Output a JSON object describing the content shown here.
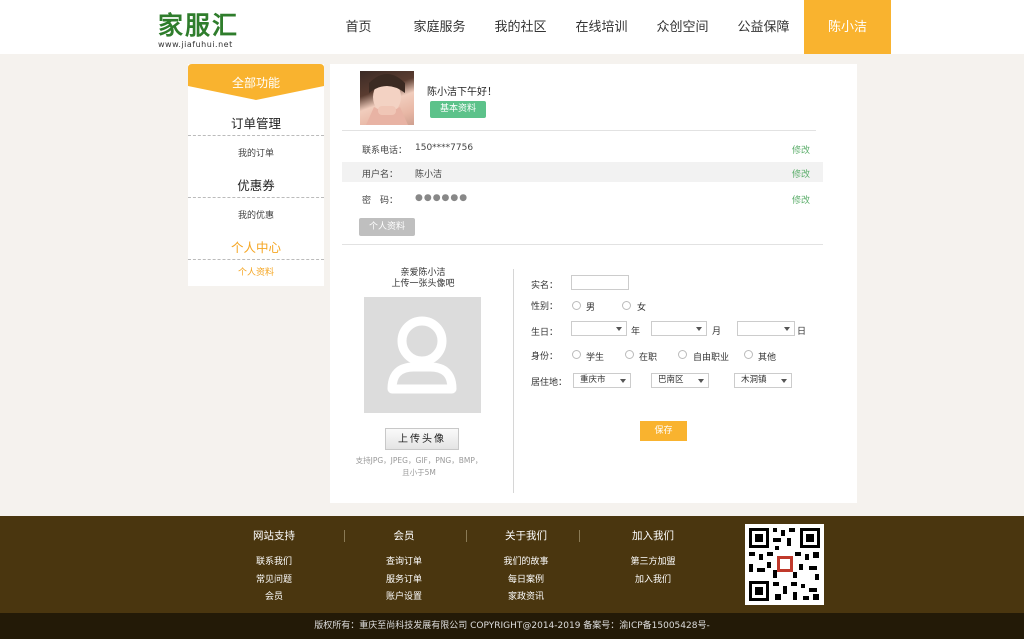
{
  "header": {
    "logo_text": "家服汇",
    "logo_url": "www.jiafuhui.net",
    "nav": [
      "首页",
      "家庭服务",
      "我的社区",
      "在线培训",
      "众创空间",
      "公益保障"
    ],
    "user_name": "陈小洁",
    "accent_color": "#f9b32f"
  },
  "sidebar": {
    "header": "全部功能",
    "sections": [
      {
        "title": "订单管理",
        "items": [
          "我的订单"
        ]
      },
      {
        "title": "优惠券",
        "items": [
          "我的优惠"
        ]
      },
      {
        "title": "个人中心",
        "items": [
          "个人资料"
        ],
        "active": true
      }
    ]
  },
  "profile": {
    "greeting": "陈小洁下午好！",
    "basic_button": "基本资料",
    "rows": [
      {
        "label": "联系电话：",
        "value": "150****7756",
        "edit": "修改"
      },
      {
        "label": "用户名：",
        "value": "陈小洁",
        "edit": "修改"
      },
      {
        "label": "密　码：",
        "value": "●●●●●●",
        "edit": "修改"
      }
    ],
    "profile_button": "个人资料"
  },
  "upload": {
    "line1": "亲爱陈小洁",
    "line2": "上传一张头像吧",
    "button": "上传头像",
    "note1": "支持JPG，JPEG，GIF，PNG，BMP，",
    "note2": "且小于5M"
  },
  "form": {
    "realname_label": "实名：",
    "gender_label": "性别：",
    "gender_options": [
      "男",
      "女"
    ],
    "birthday_label": "生日：",
    "birthday_units": [
      "年",
      "月",
      "日"
    ],
    "identity_label": "身份：",
    "identity_options": [
      "学生",
      "在职",
      "自由职业",
      "其他"
    ],
    "residence_label": "居住地：",
    "residence_values": [
      "重庆市",
      "巴南区",
      "木洞镇"
    ],
    "save_button": "保存"
  },
  "footer": {
    "columns": [
      {
        "title": "网站支持",
        "links": [
          "联系我们",
          "常见问题",
          "会员"
        ]
      },
      {
        "title": "会员",
        "links": [
          "查询订单",
          "服务订单",
          "账户设置"
        ]
      },
      {
        "title": "关于我们",
        "links": [
          "我们的故事",
          "每日案例",
          "家政资讯"
        ]
      },
      {
        "title": "加入我们",
        "links": [
          "第三方加盟",
          "加入我们"
        ]
      }
    ],
    "copyright": "版权所有：重庆至尚科技发展有限公司 COPYRIGHT@2014-2019 备案号：渝ICP备15005428号-"
  }
}
